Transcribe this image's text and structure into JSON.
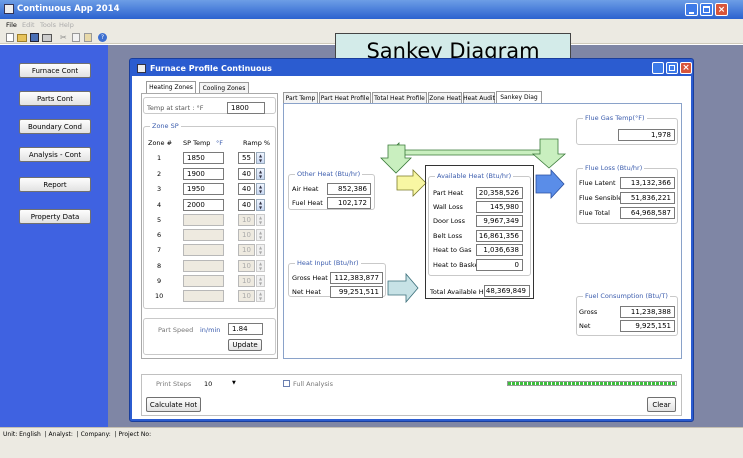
{
  "app": {
    "title": "Continuous App 2014",
    "menu": [
      "File",
      "Edit",
      "Tools",
      "Help"
    ]
  },
  "sidebar": {
    "items": [
      "Furnace Cont",
      "Parts Cont",
      "Boundary Cond",
      "Analysis - Cont",
      "Report",
      "Property Data"
    ]
  },
  "callout": "Sankey Diagram",
  "child": {
    "title": "Furnace Profile Continuous"
  },
  "zones": {
    "tabs": [
      "Heating Zones",
      "Cooling Zones"
    ],
    "temp_start_label": "Temp at start : °F",
    "temp_start_value": "1800",
    "group_title": "Zone SP",
    "col_zone": "Zone #",
    "col_sp": "SP Temp",
    "col_sp_unit": "°F",
    "col_ramp": "Ramp %",
    "rows": [
      {
        "n": "1",
        "sp": "1850",
        "ramp": "55"
      },
      {
        "n": "2",
        "sp": "1900",
        "ramp": "40"
      },
      {
        "n": "3",
        "sp": "1950",
        "ramp": "40"
      },
      {
        "n": "4",
        "sp": "2000",
        "ramp": "40"
      },
      {
        "n": "5",
        "sp": "",
        "ramp": "10"
      },
      {
        "n": "6",
        "sp": "",
        "ramp": "10"
      },
      {
        "n": "7",
        "sp": "",
        "ramp": "10"
      },
      {
        "n": "8",
        "sp": "",
        "ramp": "10"
      },
      {
        "n": "9",
        "sp": "",
        "ramp": "10"
      },
      {
        "n": "10",
        "sp": "",
        "ramp": "10"
      }
    ]
  },
  "part_speed": {
    "label": "Part Speed",
    "unit": "in/min",
    "value": "1.84",
    "update": "Update"
  },
  "right_tabs": [
    "Part Temp",
    "Part Heat Profile",
    "Total Heat Profile",
    "Zone Heat",
    "Heat Audit",
    "Sankey Diag"
  ],
  "sankey": {
    "other_heat": {
      "title": "Other Heat (Btu/hr)",
      "rows": [
        {
          "label": "Air Heat",
          "value": "852,386"
        },
        {
          "label": "Fuel Heat",
          "value": "102,172"
        }
      ]
    },
    "heat_input": {
      "title": "Heat Input (Btu/hr)",
      "rows": [
        {
          "label": "Gross Heat",
          "value": "112,383,877"
        },
        {
          "label": "Net Heat",
          "value": "99,251,511"
        }
      ]
    },
    "available": {
      "title": "Available Heat (Btu/hr)",
      "rows": [
        {
          "label": "Part Heat",
          "value": "20,358,526"
        },
        {
          "label": "Wall Loss",
          "value": "145,980"
        },
        {
          "label": "Door Loss",
          "value": "9,967,349"
        },
        {
          "label": "Belt Loss",
          "value": "16,861,356"
        },
        {
          "label": "Heat to Gas",
          "value": "1,036,638"
        },
        {
          "label": "Heat to Basket",
          "value": "0"
        }
      ],
      "total_label": "Total Available Heat",
      "total_value": "48,369,849"
    },
    "flue_temp": {
      "title": "Flue Gas Temp(°F)",
      "value": "1,978"
    },
    "flue_loss": {
      "title": "Flue Loss (Btu/hr)",
      "rows": [
        {
          "label": "Flue Latent",
          "value": "13,132,366"
        },
        {
          "label": "Flue Sensible",
          "value": "51,836,221"
        },
        {
          "label": "Flue Total",
          "value": "64,968,587"
        }
      ]
    },
    "fuel": {
      "title": "Fuel Consumption (Btu/T)",
      "rows": [
        {
          "label": "Gross",
          "value": "11,238,388"
        },
        {
          "label": "Net",
          "value": "9,925,151"
        }
      ]
    }
  },
  "bottom": {
    "print_steps_label": "Print Steps",
    "print_steps_value": "10",
    "full_analysis": "Full Analysis",
    "calc": "Calculate Hot",
    "clear": "Clear"
  },
  "status": "Unit: English  | Analyst:  | Company:  | Project No:"
}
